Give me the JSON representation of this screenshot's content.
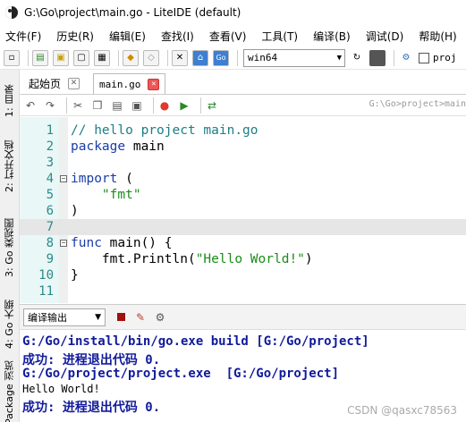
{
  "window": {
    "title": "G:\\Go\\project\\main.go - LiteIDE (default)"
  },
  "menu": [
    "文件(F)",
    "历史(R)",
    "编辑(E)",
    "查找(I)",
    "查看(V)",
    "工具(T)",
    "编译(B)",
    "调试(D)",
    "帮助(H)"
  ],
  "toolbar": {
    "target_env": "win64",
    "checkbox_label": "proj",
    "go_label": "Go"
  },
  "side_tabs": [
    "1: 目录",
    "2: 打开文档",
    "3: Go 类视图",
    "4: Go 大纲",
    "Package 浏览"
  ],
  "tabs": [
    {
      "label": "起始页"
    },
    {
      "label": "main.go"
    }
  ],
  "breadcrumb": "G:\\Go>project>main",
  "editor": {
    "lines": [
      {
        "num": "1",
        "parts": [
          {
            "t": "// hello project main.go",
            "c": "c-comment"
          }
        ]
      },
      {
        "num": "2",
        "parts": [
          {
            "t": "package",
            "c": "c-kw"
          },
          {
            "t": " main",
            "c": "c-plain"
          }
        ]
      },
      {
        "num": "3",
        "parts": []
      },
      {
        "num": "4",
        "parts": [
          {
            "t": "import",
            "c": "c-kw"
          },
          {
            "t": " (",
            "c": "c-plain"
          }
        ],
        "fold": "-"
      },
      {
        "num": "5",
        "parts": [
          {
            "t": "    ",
            "c": "c-plain"
          },
          {
            "t": "\"fmt\"",
            "c": "c-str"
          }
        ]
      },
      {
        "num": "6",
        "parts": [
          {
            "t": ")",
            "c": "c-plain"
          }
        ]
      },
      {
        "num": "7",
        "parts": [],
        "current": true
      },
      {
        "num": "8",
        "parts": [
          {
            "t": "func",
            "c": "c-kw"
          },
          {
            "t": " main() {",
            "c": "c-plain"
          }
        ],
        "fold": "-"
      },
      {
        "num": "9",
        "parts": [
          {
            "t": "    fmt.Println(",
            "c": "c-plain"
          },
          {
            "t": "\"Hello World!\"",
            "c": "c-str"
          },
          {
            "t": ")",
            "c": "c-plain"
          }
        ]
      },
      {
        "num": "10",
        "parts": [
          {
            "t": "}",
            "c": "c-plain"
          }
        ]
      },
      {
        "num": "11",
        "parts": []
      }
    ]
  },
  "output": {
    "select_label": "编译输出",
    "lines": [
      {
        "text": "G:/Go/install/bin/go.exe build [G:/Go/project]",
        "kind": "out-cmd"
      },
      {
        "text": "成功: 进程退出代码 0.",
        "kind": "out-ok"
      },
      {
        "text": "G:/Go/project/project.exe  [G:/Go/project]",
        "kind": "out-cmd"
      },
      {
        "text": "Hello World!",
        "kind": "out-plain"
      },
      {
        "text": "成功: 进程退出代码 0.",
        "kind": "out-ok"
      }
    ]
  },
  "watermark": "CSDN @qasxc78563"
}
